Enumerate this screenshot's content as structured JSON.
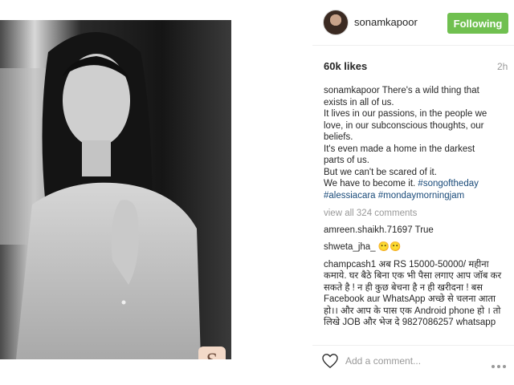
{
  "post": {
    "username": "sonamkapoor",
    "follow_label": "Following",
    "likes": "60k likes",
    "time": "2h",
    "watermark": "S"
  },
  "caption": {
    "user": "sonamkapoor",
    "lines": [
      "There's a wild thing that",
      "exists in all of us.",
      "It lives in our passions, in the people we",
      "love, in our subconscious thoughts, our",
      "beliefs.",
      "It's even made a home in the darkest",
      "parts of us.",
      "But we can't be scared of it.",
      "We have to become it."
    ],
    "tag1": "#songoftheday",
    "tag2": "#alessiacara",
    "tag3": "#mondaymorningjam"
  },
  "view_all": "view all 324 comments",
  "comments": [
    {
      "user": "amreen.shaikh.71697",
      "text": "True"
    },
    {
      "user": "shweta_jha_",
      "text": "😶😶"
    },
    {
      "user": "champcash1",
      "text": "अब RS 15000-50000/ महीना कमाये. घर बैठे बिना एक भी पैसा लगाए आप जॉब कर सकते है ! न ही कुछ बेचना है न ही खरीदना ! बस Facebook aur WhatsApp अच्छे से चलना आता हो।। और आप के पास एक Android phone हो । तो लिखे JOB और भेज दे 9827086257 whatsapp"
    }
  ],
  "footer": {
    "add_comment_placeholder": "Add a comment...",
    "like_icon": "heart-icon",
    "more_icon": "more-icon"
  },
  "colors": {
    "follow_button": "#70c050",
    "hashtag": "#1a4b7a",
    "muted": "#999999"
  }
}
